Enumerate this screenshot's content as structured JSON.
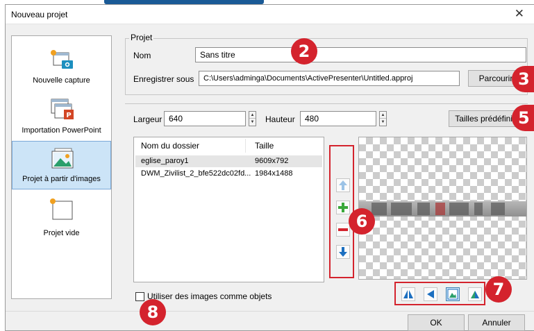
{
  "dialog": {
    "title": "Nouveau projet"
  },
  "sidebar": {
    "items": [
      {
        "label": "Nouvelle capture",
        "icon": "capture-icon"
      },
      {
        "label": "Importation PowerPoint",
        "icon": "powerpoint-icon"
      },
      {
        "label": "Projet à partir d'images",
        "icon": "images-icon",
        "active": true
      },
      {
        "label": "Projet vide",
        "icon": "blank-project-icon"
      }
    ]
  },
  "project": {
    "group_label": "Projet",
    "name_label": "Nom",
    "name_value": "Sans titre",
    "save_label": "Enregistrer sous",
    "save_value": "C:\\Users\\adminga\\Documents\\ActivePresenter\\Untitled.approj",
    "browse_label": "Parcourir"
  },
  "size": {
    "width_label": "Largeur",
    "width_value": "640",
    "height_label": "Hauteur",
    "height_value": "480",
    "presets_label": "Tailles prédéfinies"
  },
  "images_table": {
    "columns": [
      "Nom du dossier",
      "Taille"
    ],
    "rows": [
      {
        "name": "eglise_paroy1",
        "size": "9609x792"
      },
      {
        "name": "DWM_Zivilist_2_bfe522dc02fd...",
        "size": "1984x1488"
      }
    ]
  },
  "options": {
    "use_images_as_objects": "Utiliser des images comme objets"
  },
  "footer": {
    "ok_label": "OK",
    "cancel_label": "Annuler"
  },
  "callouts": {
    "c2": "2",
    "c3": "3",
    "c5": "5",
    "c6": "6",
    "c7": "7",
    "c8": "8"
  },
  "colors": {
    "accent": "#d4232d",
    "selection": "#cce4f7",
    "selection_border": "#7aa8d8",
    "dialog_bg": "#f0f0f0"
  }
}
